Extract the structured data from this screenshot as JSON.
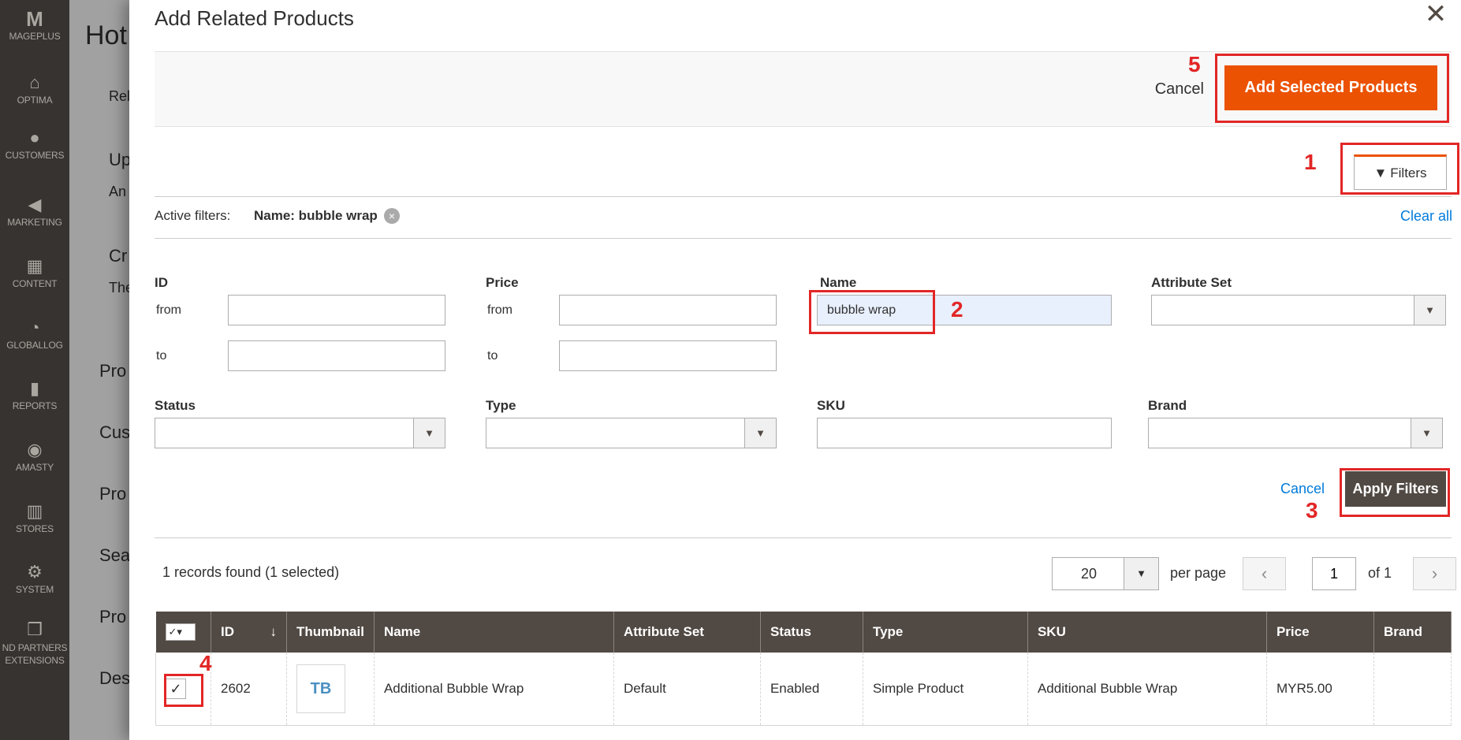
{
  "sidebar": {
    "items": [
      {
        "label": "MAGEPLUS",
        "icon": "mageplus-logo-icon",
        "glyph": "M"
      },
      {
        "label": "OPTIMA",
        "icon": "optima-icon",
        "glyph": "⌂"
      },
      {
        "label": "CUSTOMERS",
        "icon": "customers-icon",
        "glyph": "👤"
      },
      {
        "label": "MARKETING",
        "icon": "megaphone-icon",
        "glyph": "📢"
      },
      {
        "label": "CONTENT",
        "icon": "content-icon",
        "glyph": "▦"
      },
      {
        "label": "GLOBALLOG",
        "icon": "gauge-icon",
        "glyph": "◔"
      },
      {
        "label": "REPORTS",
        "icon": "bar-chart-icon",
        "glyph": "▮"
      },
      {
        "label": "AMASTY",
        "icon": "amasty-icon",
        "glyph": "◉"
      },
      {
        "label": "STORES",
        "icon": "store-icon",
        "glyph": "⌂"
      },
      {
        "label": "SYSTEM",
        "icon": "gear-icon",
        "glyph": "⚙"
      },
      {
        "label": "ND PARTNERS EXTENSIONS",
        "icon": "extensions-icon",
        "glyph": "❒"
      }
    ]
  },
  "background": {
    "title": "Hot",
    "lines": [
      "Rel",
      "Up",
      "An",
      "Cr",
      "The",
      "Pro",
      "Cus",
      "Pro",
      "Sea",
      "Pro",
      "Des"
    ]
  },
  "modal": {
    "title": "Add Related Products",
    "cancel_label": "Cancel",
    "add_label": "Add Selected Products",
    "filters_label": "Filters",
    "active_filters_label": "Active filters:",
    "active_filter_chip": "Name: bubble wrap",
    "clear_all_label": "Clear all"
  },
  "filters": {
    "id_label": "ID",
    "price_label": "Price",
    "name_label": "Name",
    "attribute_set_label": "Attribute Set",
    "from_label": "from",
    "to_label": "to",
    "name_value": "bubble wrap",
    "status_label": "Status",
    "type_label": "Type",
    "sku_label": "SKU",
    "brand_label": "Brand",
    "cancel_label": "Cancel",
    "apply_label": "Apply Filters"
  },
  "annotations": [
    "1",
    "2",
    "3",
    "4",
    "5"
  ],
  "pager": {
    "records_text": "1 records found (1 selected)",
    "per_page_value": "20",
    "per_page_label": "per page",
    "page_value": "1",
    "of_text": "of 1"
  },
  "grid": {
    "headers": [
      "ID",
      "Thumbnail",
      "Name",
      "Attribute Set",
      "Status",
      "Type",
      "SKU",
      "Price",
      "Brand"
    ],
    "rows": [
      {
        "checked": true,
        "id": "2602",
        "thumbnail_text": "TB",
        "name": "Additional Bubble Wrap",
        "attribute_set": "Default",
        "status": "Enabled",
        "type": "Simple Product",
        "sku": "Additional Bubble Wrap",
        "price": "MYR5.00",
        "brand": ""
      }
    ]
  },
  "colors": {
    "accent": "#eb5202",
    "annotation": "#e22626",
    "header_bg": "#514943",
    "link": "#007bdb",
    "sidebar_bg": "#373330"
  }
}
